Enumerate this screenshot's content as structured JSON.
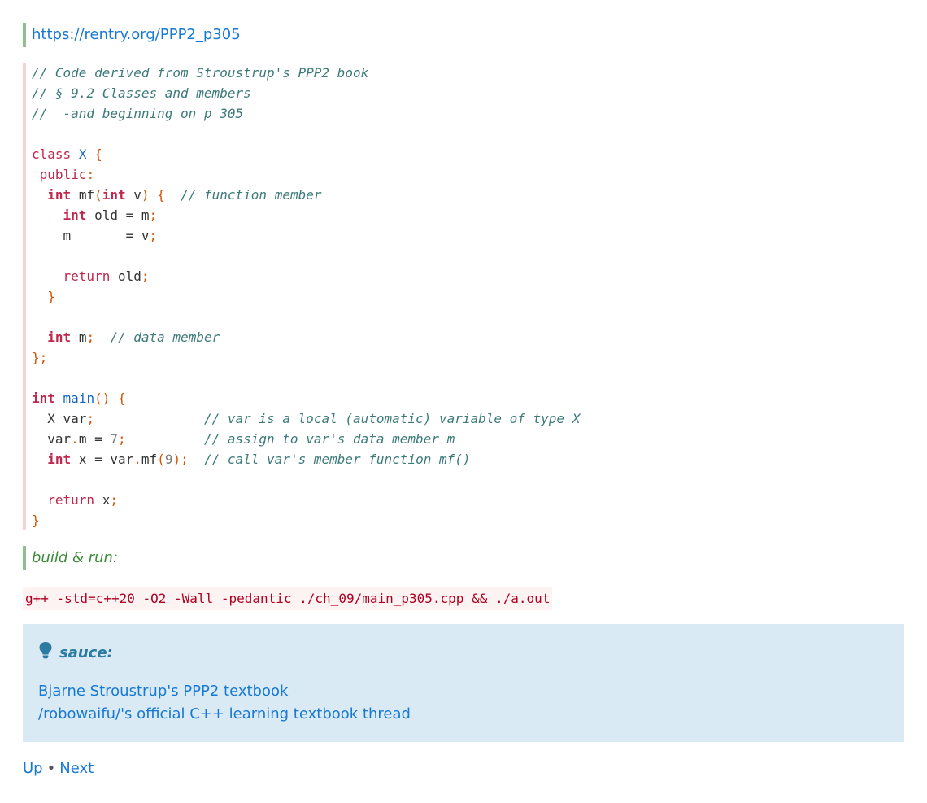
{
  "link": "https://rentry.org/PPP2_p305",
  "code": {
    "c1": "// Code derived from Stroustrup's PPP2 book",
    "c2": "// § 9.2 Classes and members",
    "c3": "//  -and beginning on p 305",
    "kw_class": "class",
    "class_name": "X",
    "kw_public": "public",
    "kw_int": "int",
    "kw_return": "return",
    "fn_mf": "mf",
    "fn_main": "main",
    "id_v": "v",
    "id_old": "old",
    "id_m": "m",
    "id_var": "var",
    "id_x": "x",
    "lit_7": "7",
    "lit_9": "9",
    "c_function_member": "// function member",
    "c_data_member": "// data member",
    "c_var_local": "// var is a local (automatic) variable of type X",
    "c_assign": "// assign to var's data member m",
    "c_call": "// call var's member function mf()"
  },
  "build_label": "build & run:",
  "command": "g++ -std=c++20 -O2 -Wall -pedantic ./ch_09/main_p305.cpp && ./a.out",
  "admonition": {
    "icon": "lightbulb-icon",
    "title": "sauce:",
    "links": [
      "Bjarne Stroustrup's PPP2 textbook",
      "/robowaifu/'s official C++ learning textbook thread"
    ]
  },
  "footer": {
    "up": "Up",
    "separator": "•",
    "next": "Next"
  },
  "colors": {
    "link": "#1779d4",
    "comment": "#3d7a7a",
    "keyword": "#c1264c",
    "identifier": "#1565c0",
    "punctuation": "#d35400",
    "admonition_bg": "#d9eaf4"
  }
}
